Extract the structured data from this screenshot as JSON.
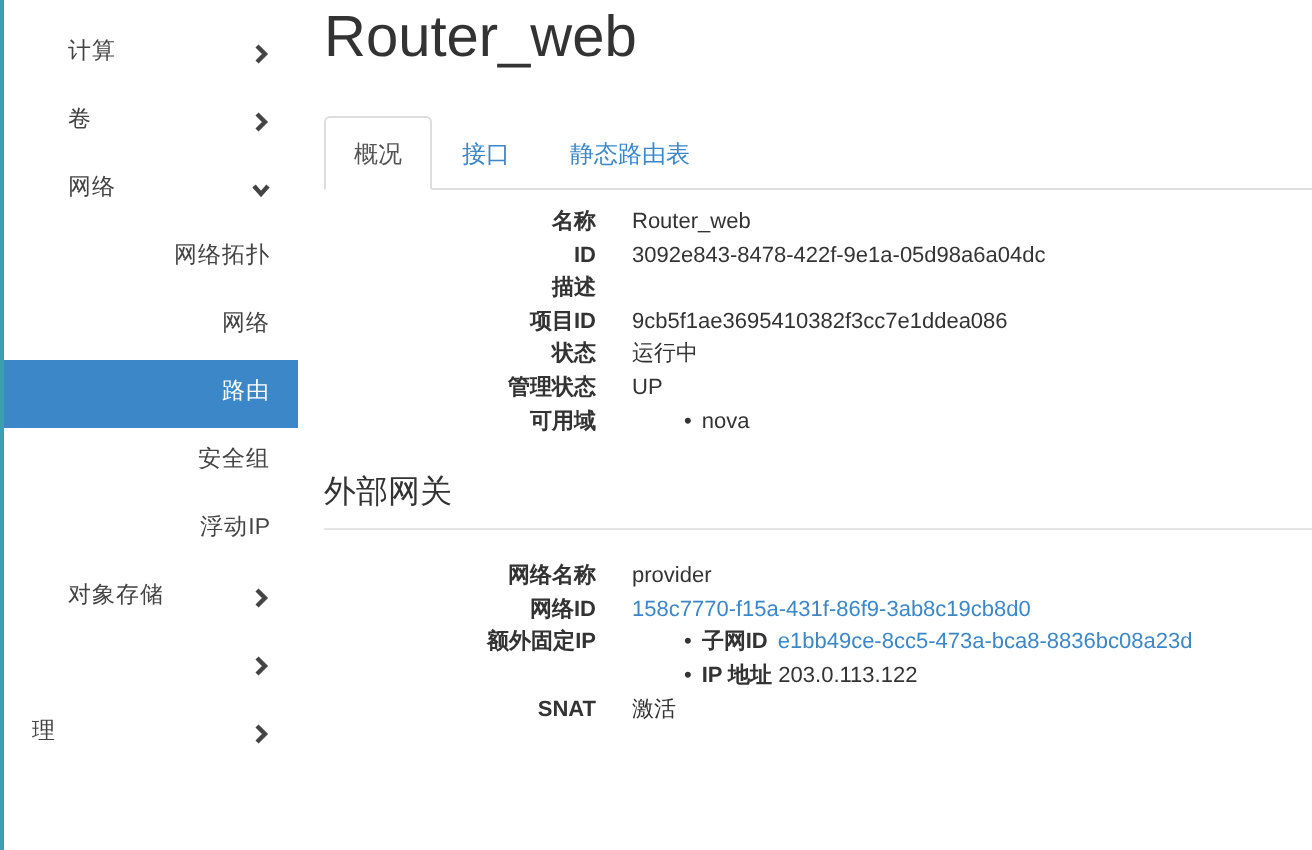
{
  "sidebar": {
    "items": [
      {
        "label": "计算",
        "kind": "group",
        "expanded": false
      },
      {
        "label": "卷",
        "kind": "group",
        "expanded": false
      },
      {
        "label": "网络",
        "kind": "group",
        "expanded": true
      },
      {
        "label": "网络拓扑",
        "kind": "sub",
        "selected": false
      },
      {
        "label": "网络",
        "kind": "sub",
        "selected": false
      },
      {
        "label": "路由",
        "kind": "sub",
        "selected": true
      },
      {
        "label": "安全组",
        "kind": "sub",
        "selected": false
      },
      {
        "label": "浮动IP",
        "kind": "sub",
        "selected": false
      },
      {
        "label": "对象存储",
        "kind": "group",
        "expanded": false
      },
      {
        "kind": "group",
        "expanded": false
      },
      {
        "label": "理",
        "kind": "group",
        "expanded": false
      }
    ]
  },
  "page_title": "Router_web",
  "tabs": [
    {
      "label": "概况",
      "selected": true
    },
    {
      "label": "接口",
      "selected": false
    },
    {
      "label": "静态路由表",
      "selected": false
    }
  ],
  "overview": [
    {
      "label": "名称",
      "value": "Router_web"
    },
    {
      "label": "ID",
      "value": "3092e843-8478-422f-9e1a-05d98a6a04dc"
    },
    {
      "label": "描述"
    },
    {
      "label": "项目ID",
      "value": "9cb5f1ae3695410382f3cc7e1ddea086"
    },
    {
      "label": "状态",
      "value": "运行中"
    },
    {
      "label": "管理状态",
      "value": "UP"
    },
    {
      "label": "可用域",
      "list": [
        {
          "bullet": "•",
          "value": "nova"
        }
      ]
    }
  ],
  "gateway": {
    "heading": "外部网关",
    "fields": [
      {
        "label": "网络名称",
        "value": "provider"
      },
      {
        "label": "网络ID",
        "value": "158c7770-f15a-431f-86f9-3ab8c19cb8d0",
        "link": true
      },
      {
        "label": "额外固定IP",
        "list": [
          {
            "bullet": "•",
            "label": "子网ID",
            "value": "e1bb49ce-8cc5-473a-bca8-8836bc08a23d",
            "link": true
          },
          {
            "bullet": "•",
            "label": "IP 地址",
            "value": "203.0.113.122"
          }
        ]
      },
      {
        "label": "SNAT",
        "value": "激活"
      }
    ]
  }
}
